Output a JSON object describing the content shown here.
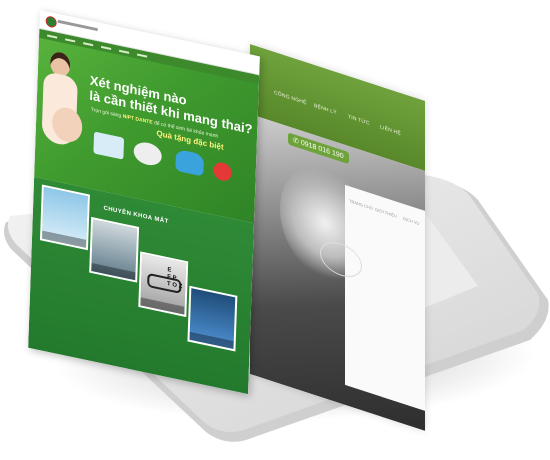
{
  "front_site": {
    "hero": {
      "title_line1": "Xét nghiệm nào",
      "title_line2": "là cần thiết khi mang thai?",
      "subtitle_prefix": "Trọn gói sàng ",
      "subtitle_brand": "NIPT DANTE",
      "subtitle_suffix": " để có thể sinh bé khỏe mạnh",
      "highlight": "Quà tặng đặc biệt"
    },
    "section": {
      "title": "CHUYÊN KHOA MẮT"
    },
    "eye_chart": [
      "E",
      "F P",
      "T O Z"
    ]
  },
  "back_site": {
    "nav_items": [
      "CÔNG NGHỆ",
      "BỆNH LÝ",
      "TIN TỨC",
      "LIÊN HỆ"
    ],
    "phone": "0918 016 190",
    "panel_links": [
      "TRANG CHỦ",
      "GIỚI THIỆU",
      "DỊCH VỤ"
    ]
  },
  "colors": {
    "brand_green": "#3f9a2e",
    "dark_green": "#237a2d",
    "accent_red": "#e53935",
    "highlight_yellow": "#fff37a"
  }
}
